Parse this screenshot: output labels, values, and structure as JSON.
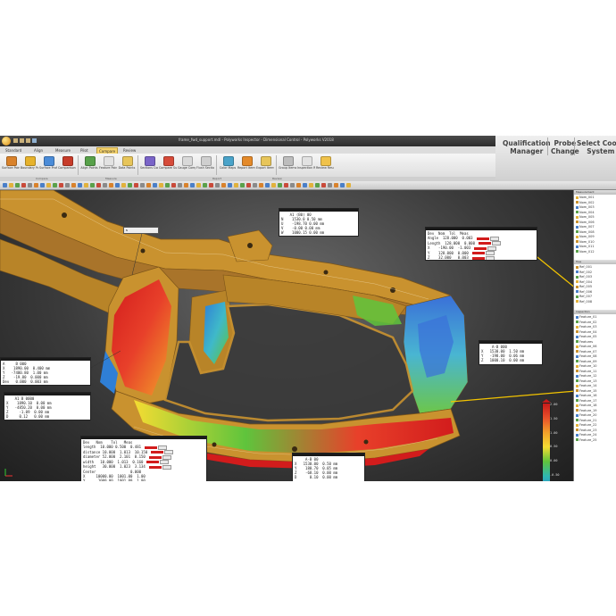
{
  "window": {
    "title": "frame_fwd_support.mdl  -  Polyworks Inspector - Dimensional Control   -  Polyworks V2018"
  },
  "promo": {
    "items": [
      {
        "label": "Qualification\nManager"
      },
      {
        "label": "Probe\nChange"
      },
      {
        "label": "Select Coord\nSystem"
      }
    ]
  },
  "ribbon": {
    "tabs": [
      "Standard",
      "Align",
      "Measure",
      "Pilot",
      "Compare",
      "Review"
    ],
    "active_tab": "Compare",
    "buttons": [
      {
        "label": "Surface\nPoints",
        "color": "#d9822b"
      },
      {
        "label": "Boundary\nPoints",
        "color": "#e6b22c"
      },
      {
        "label": "Surface Profile\nPoints",
        "color": "#4b8cd8"
      },
      {
        "label": "Comparison\nPoints",
        "color": "#c73c2a"
      },
      {
        "label": "Align\nPoints",
        "color": "#58a14a"
      },
      {
        "label": "Feature\nPoints",
        "color": "#e2e2e2"
      },
      {
        "label": "Data\nPoints",
        "color": "#e7c55a"
      },
      {
        "label": "Sections\nCompare",
        "color": "#7a64c8"
      },
      {
        "label": "Compare\nSurface",
        "color": "#d64b3a"
      },
      {
        "label": "Gauge\nCompare",
        "color": "#d9d9d9"
      },
      {
        "label": "Flush\nSections",
        "color": "#cfcfcf"
      },
      {
        "label": "Color\nMaps",
        "color": "#4aa3c9"
      },
      {
        "label": "Report\nItems",
        "color": "#e48a2a"
      },
      {
        "label": "Export\nItems",
        "color": "#e7c55a"
      },
      {
        "label": "Group\nItems",
        "color": "#bdbdbd"
      },
      {
        "label": "Inspection\nReport",
        "color": "#e2e2e2"
      },
      {
        "label": "Review\nResults",
        "color": "#f0c24a"
      }
    ],
    "groups": [
      "Compare",
      "Measure",
      "Report",
      "Review"
    ]
  },
  "annotations": [
    {
      "name": "callout-top-center",
      "rows": [
        {
          "t": "    A1 (B0) 00"
        },
        {
          "t": "N    1530.0 0.50 mm"
        },
        {
          "t": "U    -198.70 0.00 mm"
        },
        {
          "t": "V    -0.00 0.00 mm"
        },
        {
          "t": "W    1000.15 0.00 mm"
        }
      ]
    },
    {
      "name": "callout-top-right",
      "rows": [
        {
          "t": "Dev  Nom  Tol  Meas",
          "bars": false
        },
        {
          "t": "Angle  128.000  0.003",
          "bars": true
        },
        {
          "t": "Length  128.000  0.000",
          "bars": true
        },
        {
          "t": "X    -190.00  -1.003",
          "bars": true
        },
        {
          "t": "Y    128.000  0.000",
          "bars": true
        },
        {
          "t": "Z    32.000   0.003",
          "bars": true
        }
      ]
    },
    {
      "name": "callout-left",
      "rows": [
        {
          "t": "A     B 000"
        },
        {
          "t": "X    1890.00  0.400 mm"
        },
        {
          "t": "Y   -7400.80  1.00 mm"
        },
        {
          "t": "Z    -19.80  0.000 mm"
        },
        {
          "t": "Dev   0.000  0.003 mm"
        }
      ]
    },
    {
      "name": "callout-lower-left",
      "rows": [
        {
          "t": "    A1 B 0000"
        },
        {
          "t": "X    1890.10  0.00 mm"
        },
        {
          "t": "Y   -4850.20  0.00 mm"
        },
        {
          "t": "Z     -1.09  0.00 mm"
        },
        {
          "t": "D     0.12   0.00 mm"
        }
      ]
    },
    {
      "name": "callout-bottom-center",
      "rows": [
        {
          "t": "Dev   Nom    Tol   Meas",
          "bars": false
        },
        {
          "t": "length  10.000 0.500  0.481",
          "bars": true
        },
        {
          "t": "distance 10.000  1.013  10.150",
          "bars": true
        },
        {
          "t": "diameter 52.000  2.101  0.150",
          "bars": true
        },
        {
          "t": "width   10.000  1.013  0.160",
          "bars": true
        },
        {
          "t": "height   30.000  1.023  3.134",
          "bars": true
        },
        {
          "t": "Center                0.000",
          "bars": false
        },
        {
          "t": "X     10000.00  1001.00  1.00",
          "bars": false
        },
        {
          "t": "Y      1000.00  1001.00  1.00",
          "bars": false
        },
        {
          "t": "Z      1000.00  1001.00  1.00",
          "bars": false
        }
      ]
    },
    {
      "name": "callout-mid-right",
      "rows": [
        {
          "t": "     A-B 000"
        },
        {
          "t": "X   1530.00  1.50 mm"
        },
        {
          "t": "Y   -198.00  0.06 mm"
        },
        {
          "t": "Z   1000.10  0.00 mm"
        }
      ]
    },
    {
      "name": "callout-bottom-right",
      "rows": [
        {
          "t": "     A-B 00"
        },
        {
          "t": "X   1530.00  0.50 mm"
        },
        {
          "t": "Y    180.70  0.05 mm"
        },
        {
          "t": "Z    -68.10  0.00 mm"
        },
        {
          "t": "D      0.10  0.00 mm"
        }
      ]
    }
  ],
  "legend": {
    "ticks": [
      "2.00",
      "1.50",
      "1.00",
      "0.50",
      "0.00",
      "-0.50",
      "-1.00",
      "-1.50",
      "-2.00"
    ],
    "colors": [
      "#c81a1a",
      "#e8502a",
      "#f1a02a",
      "#f4dc32",
      "#5fc43c",
      "#2fb7b0",
      "#2a8ad8",
      "#2453c6",
      "#19319a"
    ]
  },
  "tree": {
    "sections": [
      {
        "header": "Measurement",
        "items": [
          "Nom_001",
          "Nom_002",
          "Nom_003",
          "Nom_004",
          "Nom_005",
          "Nom_006",
          "Nom_007",
          "Nom_008",
          "Nom_009",
          "Nom_010",
          "Nom_011",
          "Nom_012"
        ]
      },
      {
        "header": "Tree",
        "items": [
          "Ref_001",
          "Ref_002",
          "Ref_003",
          "Ref_004",
          "Ref_005",
          "Ref_006",
          "Ref_007",
          "Ref_008"
        ]
      },
      {
        "header": "Inspection",
        "items": [
          "Feature_01",
          "Feature_02",
          "Feature_03",
          "Feature_04",
          "Feature_05",
          "Features",
          "Feature_06",
          "Feature_07",
          "Feature_08",
          "Feature_09",
          "Feature_10",
          "Feature_11",
          "Feature_12",
          "Feature_13",
          "Feature_14",
          "Feature_15",
          "Feature_16",
          "Feature_17",
          "Feature_18",
          "Feature_19",
          "Feature_20",
          "Feature_21",
          "Feature_22",
          "Feature_23",
          "Feature_24",
          "Feature_25"
        ]
      }
    ]
  },
  "colors": {
    "model_body": "#c9922f",
    "model_shadow": "#8e6320",
    "leader_line": "#f3c400"
  }
}
